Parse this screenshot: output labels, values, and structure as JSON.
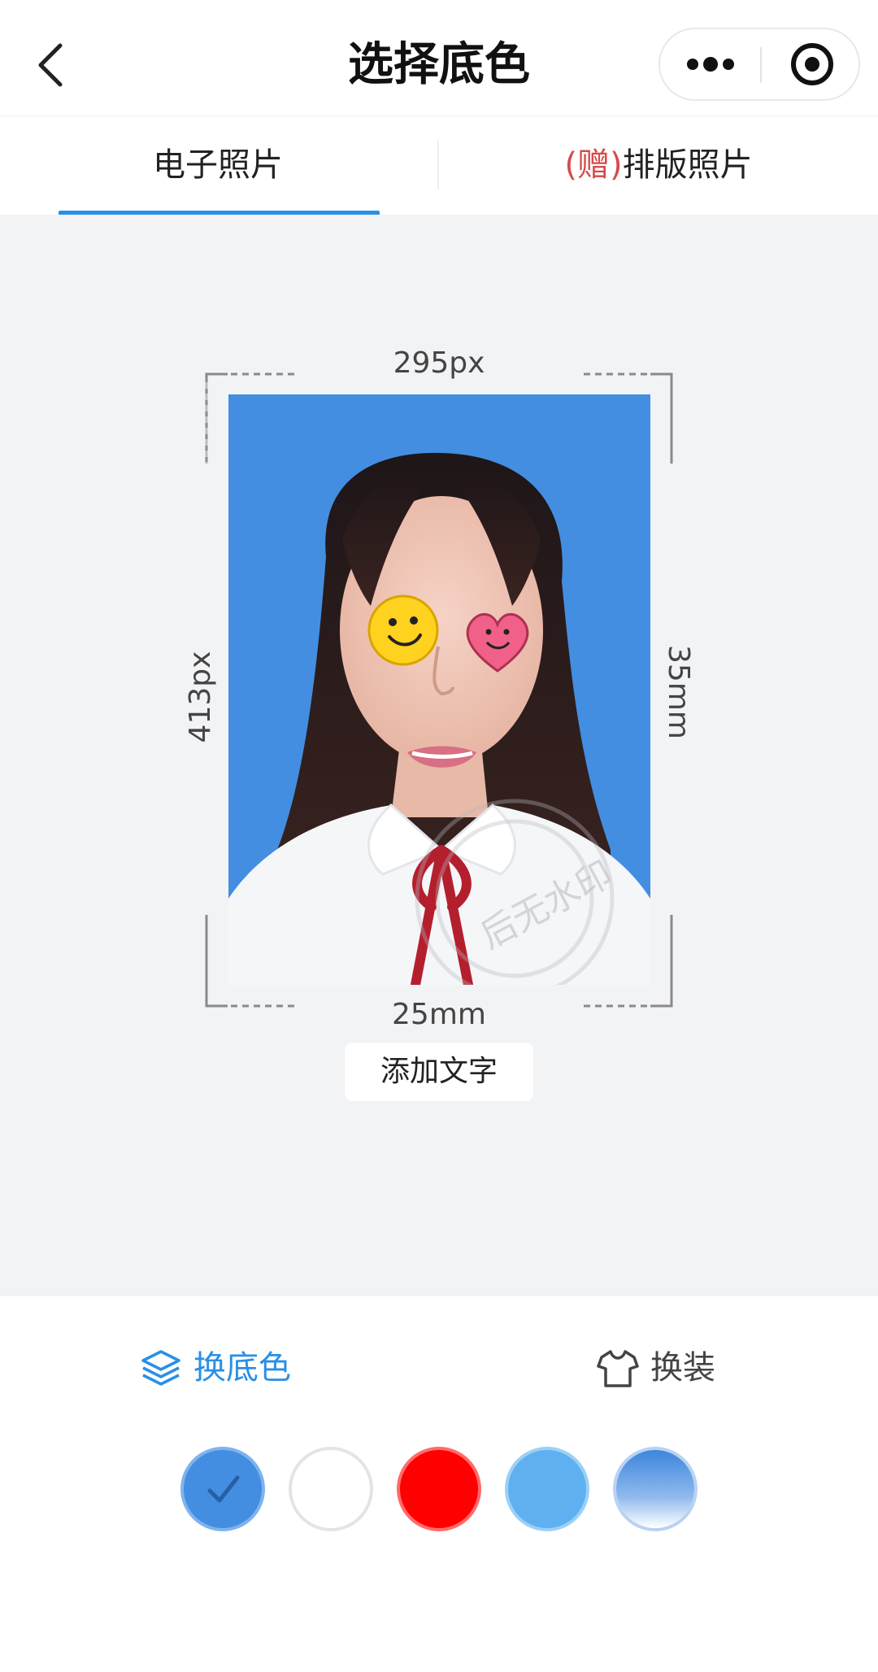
{
  "header": {
    "title": "选择底色",
    "back_icon": "chevron-left-icon",
    "more_icon": "more-dots-icon",
    "close_icon": "target-circle-icon"
  },
  "tabs": [
    {
      "label": "电子照片",
      "active": true
    },
    {
      "prefix": "(赠)",
      "label": "排版照片",
      "active": false
    }
  ],
  "preview": {
    "width_px": "295px",
    "height_px": "413px",
    "width_mm": "25mm",
    "height_mm": "35mm",
    "watermark_text": "后无水印",
    "add_text_label": "添加文字"
  },
  "options": {
    "change_bg_label": "换底色",
    "change_bg_icon": "layers-icon",
    "change_outfit_label": "换装",
    "change_outfit_icon": "tshirt-icon"
  },
  "swatches": [
    {
      "name": "blue",
      "color": "#438ee0",
      "selected": true
    },
    {
      "name": "white",
      "color": "#ffffff",
      "selected": false
    },
    {
      "name": "red",
      "color": "#ff0000",
      "selected": false
    },
    {
      "name": "light-blue",
      "color": "#5fb0f0",
      "selected": false
    },
    {
      "name": "gradient-blue",
      "color": "#3d86dc",
      "selected": false
    }
  ],
  "accent_color": "#2a8fe6"
}
